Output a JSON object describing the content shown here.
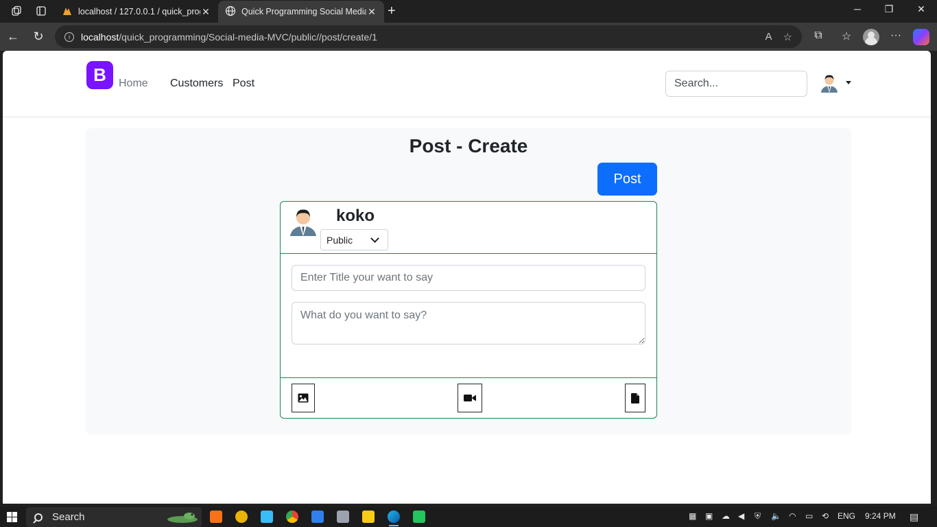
{
  "browser": {
    "tabs": [
      {
        "title": "localhost / 127.0.0.1 / quick_progr",
        "active": false
      },
      {
        "title": "Quick Programming Social Media",
        "active": true
      }
    ],
    "url_host": "localhost",
    "url_path": "/quick_programming/Social-media-MVC/public//post/create/1"
  },
  "navbar": {
    "brand": "B",
    "links": [
      "Home",
      "Customers",
      "Post"
    ],
    "search_placeholder": "Search..."
  },
  "page": {
    "title": "Post - Create",
    "post_button": "Post"
  },
  "card": {
    "username": "koko",
    "privacy_options": [
      "Public"
    ],
    "privacy_selected": "Public",
    "title_placeholder": "Enter Title your want to say",
    "body_placeholder": "What do you want to say?"
  },
  "taskbar": {
    "search_label": "Search",
    "language": "ENG",
    "time": "9:24 PM"
  }
}
